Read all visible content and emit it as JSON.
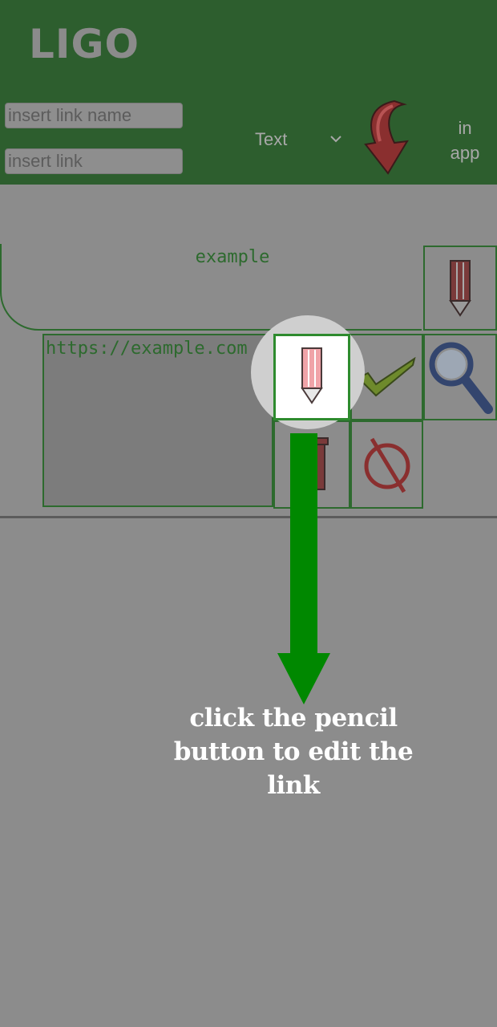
{
  "app": {
    "title": "LIGO"
  },
  "form": {
    "name_placeholder": "insert link name",
    "link_placeholder": "insert link",
    "type_select": "Text",
    "in_app_label": "in\napp"
  },
  "icons": {
    "download": "download-arrow-icon",
    "chevron": "chevron-down-icon",
    "edit": "pencil-icon",
    "confirm": "checkmark-icon",
    "search": "magnifier-icon",
    "delete": "trash-icon",
    "cancel": "cancel-icon"
  },
  "card": {
    "title": "example",
    "url": "https://example.com"
  },
  "tutorial": {
    "hint": "click the pencil button to edit the link"
  },
  "colors": {
    "header": "#2d5e2e",
    "card_border": "#2d6a2e",
    "overlay": "#8c8c8c",
    "arrow": "#008800"
  }
}
